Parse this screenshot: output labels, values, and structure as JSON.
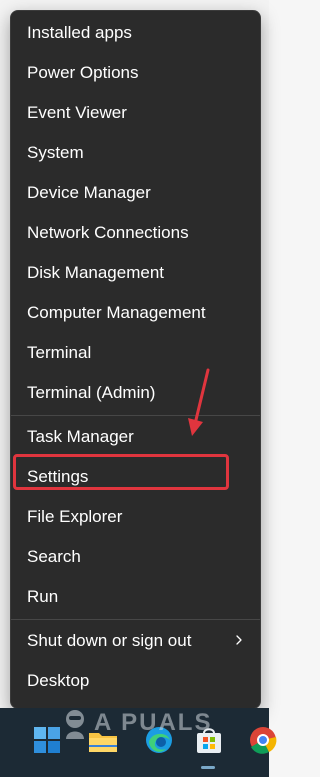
{
  "menu": {
    "items": [
      {
        "label": "Installed apps"
      },
      {
        "label": "Power Options"
      },
      {
        "label": "Event Viewer"
      },
      {
        "label": "System"
      },
      {
        "label": "Device Manager"
      },
      {
        "label": "Network Connections"
      },
      {
        "label": "Disk Management"
      },
      {
        "label": "Computer Management"
      },
      {
        "label": "Terminal"
      },
      {
        "label": "Terminal (Admin)"
      },
      {
        "label": "Task Manager"
      },
      {
        "label": "Settings"
      },
      {
        "label": "File Explorer"
      },
      {
        "label": "Search"
      },
      {
        "label": "Run"
      },
      {
        "label": "Shut down or sign out"
      },
      {
        "label": "Desktop"
      }
    ]
  },
  "annotation": {
    "highlighted_item": "Settings",
    "highlight_color": "#e0353e",
    "arrow_color": "#e0353e"
  },
  "watermark": {
    "text": "A PUALS"
  },
  "taskbar": {
    "icons": [
      {
        "icon": "windows-start-icon"
      },
      {
        "icon": "file-explorer-icon"
      },
      {
        "icon": "edge-browser-icon"
      },
      {
        "icon": "microsoft-store-icon"
      },
      {
        "icon": "chrome-icon"
      }
    ]
  },
  "colors": {
    "menu_bg": "#2b2b2b",
    "menu_text": "#ffffff",
    "taskbar_bg": "#1c2a35"
  }
}
